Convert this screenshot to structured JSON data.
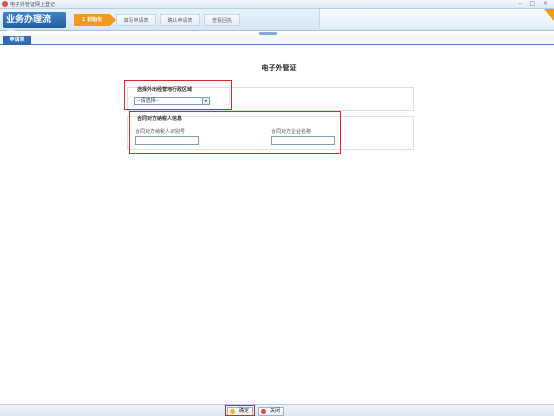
{
  "window": {
    "title": "电子外管证网上登记",
    "controls": "– □ ×"
  },
  "flow": {
    "title": "业务办理流程：",
    "steps": [
      {
        "number": "1",
        "label": "初始化"
      },
      {
        "label": "填写申请表"
      },
      {
        "label": "确认申请表"
      },
      {
        "label": "查看回执"
      }
    ]
  },
  "tabs": [
    {
      "label": "申请表"
    }
  ],
  "form": {
    "title": "电子外管证",
    "region_section": {
      "label": "选择外出经营地行政区域",
      "select_value": "--请选择--",
      "dropdown": "▾"
    },
    "partner_section": {
      "label": "合同对方纳税人信息",
      "taxpayer_id_label": "合同对方纳税人识别号",
      "taxpayer_id_value": "",
      "company_name_label": "合同对方企业名称",
      "company_name_value": ""
    }
  },
  "footer": {
    "confirm_label": "确定",
    "close_label": "关闭"
  },
  "colors": {
    "brand_blue": "#2f6bb0",
    "step_active": "#f39a1d",
    "highlight_red": "#e32424"
  }
}
